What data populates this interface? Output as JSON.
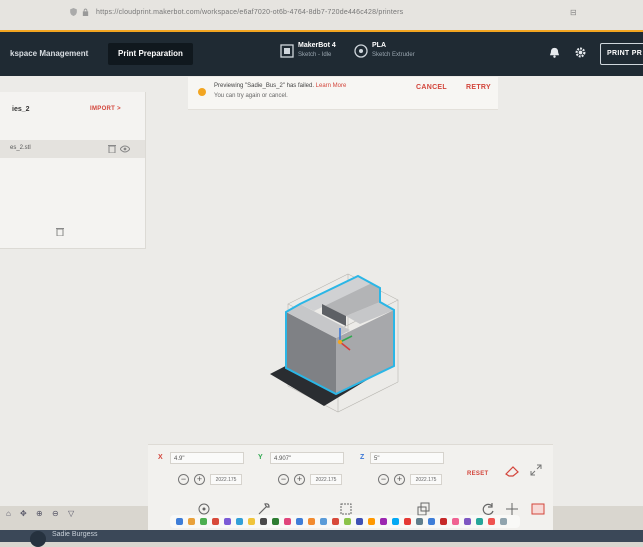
{
  "browser": {
    "url": "https://cloudprint.makerbot.com/workspace/e6af7020-ot6b-4764-8db7-720de446c428/printers"
  },
  "header": {
    "nav_workspace": "kspace Management",
    "nav_print_prep": "Print Preparation",
    "printer_name": "MakerBot 4",
    "printer_sub": "Sketch - Idle",
    "material_name": "PLA",
    "material_sub": "Sketch Extruder",
    "print_button": "PRINT PR"
  },
  "sidebar": {
    "title": "ies_2",
    "import_label": "IMPORT  >",
    "file_name": "es_2.stl"
  },
  "notice": {
    "message_prefix": "Previewing \"Sadie_Bus_2\" has failed.",
    "link": "Learn More",
    "message_line2": "You can try again or cancel.",
    "cancel": "CANCEL",
    "retry": "RETRY"
  },
  "transform": {
    "x_label": "X",
    "x_value": "4.9\"",
    "y_label": "Y",
    "y_value": "4.907\"",
    "z_label": "Z",
    "z_value": "5\"",
    "x_mm": "2022.175",
    "y_mm": "2022.175",
    "z_mm": "2022.175",
    "reset": "RESET"
  },
  "user": {
    "name": "Sadie Burgess"
  },
  "colors": {
    "accent_orange": "#f2a521",
    "action_red": "#d3453b",
    "header_bg": "#1f2a33",
    "model_outline": "#2bb6e6"
  }
}
